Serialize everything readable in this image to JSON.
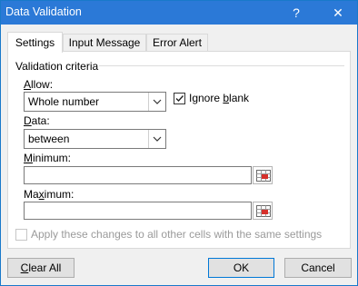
{
  "window": {
    "title": "Data Validation",
    "help_label": "?",
    "close_label": "✕"
  },
  "tabs": [
    {
      "label": "Settings",
      "active": true
    },
    {
      "label": "Input Message",
      "active": false
    },
    {
      "label": "Error Alert",
      "active": false
    }
  ],
  "settings": {
    "group_label": "Validation criteria",
    "allow": {
      "label_prefix": "",
      "label_mnemonic": "A",
      "label_suffix": "llow:",
      "value": "Whole number"
    },
    "ignore_blank": {
      "label_prefix": "Ignore ",
      "label_mnemonic": "b",
      "label_suffix": "lank",
      "checked": true
    },
    "data": {
      "label_prefix": "",
      "label_mnemonic": "D",
      "label_suffix": "ata:",
      "value": "between"
    },
    "minimum": {
      "label_prefix": "",
      "label_mnemonic": "M",
      "label_suffix": "inimum:",
      "value": ""
    },
    "maximum": {
      "label_prefix": "Ma",
      "label_mnemonic": "x",
      "label_suffix": "imum:",
      "value": ""
    },
    "apply_all": {
      "label": "Apply these changes to all other cells with the same settings",
      "checked": false,
      "enabled": false
    }
  },
  "buttons": {
    "clear_all": {
      "prefix": "",
      "mnemonic": "C",
      "suffix": "lear All"
    },
    "ok": "OK",
    "cancel": "Cancel"
  }
}
